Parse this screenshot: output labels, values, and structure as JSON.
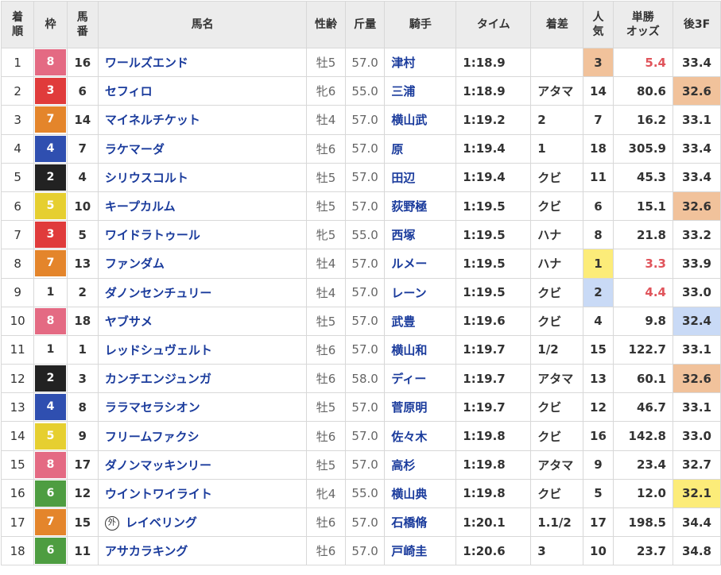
{
  "headers": {
    "rank": [
      "着",
      "順"
    ],
    "waku": "枠",
    "umaban": [
      "馬",
      "番"
    ],
    "name": "馬名",
    "sexage": "性齢",
    "weight": "斤量",
    "jockey": "騎手",
    "time": "タイム",
    "margin": "着差",
    "pop": [
      "人",
      "気"
    ],
    "odds": [
      "単勝",
      "オッズ"
    ],
    "last3f": "後3F"
  },
  "waku_colors": {
    "1": {
      "bg": "#ffffff",
      "fg": "#333333"
    },
    "2": {
      "bg": "#222222",
      "fg": "#ffffff"
    },
    "3": {
      "bg": "#e03b3b",
      "fg": "#ffffff"
    },
    "4": {
      "bg": "#2f4fb0",
      "fg": "#ffffff"
    },
    "5": {
      "bg": "#e6cf30",
      "fg": "#ffffff"
    },
    "6": {
      "bg": "#4e9d41",
      "fg": "#ffffff"
    },
    "7": {
      "bg": "#e4852b",
      "fg": "#ffffff"
    },
    "8": {
      "bg": "#e46a83",
      "fg": "#ffffff"
    }
  },
  "rows": [
    {
      "rank": "1",
      "waku": "8",
      "umaban": "16",
      "name": "ワールズエンド",
      "foreign": "",
      "sexage": "牡5",
      "weight": "57.0",
      "jockey": "津村",
      "time": "1:18.9",
      "margin": "",
      "pop": "3",
      "odds": "5.4",
      "last3f": "33.4",
      "pop_hl": "3",
      "last_hl": ""
    },
    {
      "rank": "2",
      "waku": "3",
      "umaban": "6",
      "name": "セフィロ",
      "foreign": "",
      "sexage": "牝6",
      "weight": "55.0",
      "jockey": "三浦",
      "time": "1:18.9",
      "margin": "アタマ",
      "pop": "14",
      "odds": "80.6",
      "last3f": "32.6",
      "pop_hl": "",
      "last_hl": "3"
    },
    {
      "rank": "3",
      "waku": "7",
      "umaban": "14",
      "name": "マイネルチケット",
      "foreign": "",
      "sexage": "牡4",
      "weight": "57.0",
      "jockey": "横山武",
      "time": "1:19.2",
      "margin": "2",
      "pop": "7",
      "odds": "16.2",
      "last3f": "33.1",
      "pop_hl": "",
      "last_hl": ""
    },
    {
      "rank": "4",
      "waku": "4",
      "umaban": "7",
      "name": "ラケマーダ",
      "foreign": "",
      "sexage": "牡6",
      "weight": "57.0",
      "jockey": "原",
      "time": "1:19.4",
      "margin": "1",
      "pop": "18",
      "odds": "305.9",
      "last3f": "33.4",
      "pop_hl": "",
      "last_hl": ""
    },
    {
      "rank": "5",
      "waku": "2",
      "umaban": "4",
      "name": "シリウスコルト",
      "foreign": "",
      "sexage": "牡5",
      "weight": "57.0",
      "jockey": "田辺",
      "time": "1:19.4",
      "margin": "クビ",
      "pop": "11",
      "odds": "45.3",
      "last3f": "33.4",
      "pop_hl": "",
      "last_hl": ""
    },
    {
      "rank": "6",
      "waku": "5",
      "umaban": "10",
      "name": "キープカルム",
      "foreign": "",
      "sexage": "牡5",
      "weight": "57.0",
      "jockey": "荻野極",
      "time": "1:19.5",
      "margin": "クビ",
      "pop": "6",
      "odds": "15.1",
      "last3f": "32.6",
      "pop_hl": "",
      "last_hl": "3"
    },
    {
      "rank": "7",
      "waku": "3",
      "umaban": "5",
      "name": "ワイドラトゥール",
      "foreign": "",
      "sexage": "牝5",
      "weight": "55.0",
      "jockey": "西塚",
      "time": "1:19.5",
      "margin": "ハナ",
      "pop": "8",
      "odds": "21.8",
      "last3f": "33.2",
      "pop_hl": "",
      "last_hl": ""
    },
    {
      "rank": "8",
      "waku": "7",
      "umaban": "13",
      "name": "ファンダム",
      "foreign": "",
      "sexage": "牡4",
      "weight": "57.0",
      "jockey": "ルメー",
      "time": "1:19.5",
      "margin": "ハナ",
      "pop": "1",
      "odds": "3.3",
      "last3f": "33.9",
      "pop_hl": "1",
      "last_hl": ""
    },
    {
      "rank": "9",
      "waku": "1",
      "umaban": "2",
      "name": "ダノンセンチュリー",
      "foreign": "",
      "sexage": "牡4",
      "weight": "57.0",
      "jockey": "レーン",
      "time": "1:19.5",
      "margin": "クビ",
      "pop": "2",
      "odds": "4.4",
      "last3f": "33.0",
      "pop_hl": "2",
      "last_hl": ""
    },
    {
      "rank": "10",
      "waku": "8",
      "umaban": "18",
      "name": "ヤブサメ",
      "foreign": "",
      "sexage": "牡5",
      "weight": "57.0",
      "jockey": "武豊",
      "time": "1:19.6",
      "margin": "クビ",
      "pop": "4",
      "odds": "9.8",
      "last3f": "32.4",
      "pop_hl": "",
      "last_hl": "2"
    },
    {
      "rank": "11",
      "waku": "1",
      "umaban": "1",
      "name": "レッドシュヴェルト",
      "foreign": "",
      "sexage": "牡6",
      "weight": "57.0",
      "jockey": "横山和",
      "time": "1:19.7",
      "margin": "1/2",
      "pop": "15",
      "odds": "122.7",
      "last3f": "33.1",
      "pop_hl": "",
      "last_hl": ""
    },
    {
      "rank": "12",
      "waku": "2",
      "umaban": "3",
      "name": "カンチエンジュンガ",
      "foreign": "",
      "sexage": "牡6",
      "weight": "58.0",
      "jockey": "ディー",
      "time": "1:19.7",
      "margin": "アタマ",
      "pop": "13",
      "odds": "60.1",
      "last3f": "32.6",
      "pop_hl": "",
      "last_hl": "3"
    },
    {
      "rank": "13",
      "waku": "4",
      "umaban": "8",
      "name": "ララマセラシオン",
      "foreign": "",
      "sexage": "牡5",
      "weight": "57.0",
      "jockey": "菅原明",
      "time": "1:19.7",
      "margin": "クビ",
      "pop": "12",
      "odds": "46.7",
      "last3f": "33.1",
      "pop_hl": "",
      "last_hl": ""
    },
    {
      "rank": "14",
      "waku": "5",
      "umaban": "9",
      "name": "フリームファクシ",
      "foreign": "",
      "sexage": "牡6",
      "weight": "57.0",
      "jockey": "佐々木",
      "time": "1:19.8",
      "margin": "クビ",
      "pop": "16",
      "odds": "142.8",
      "last3f": "33.0",
      "pop_hl": "",
      "last_hl": ""
    },
    {
      "rank": "15",
      "waku": "8",
      "umaban": "17",
      "name": "ダノンマッキンリー",
      "foreign": "",
      "sexage": "牡5",
      "weight": "57.0",
      "jockey": "高杉",
      "time": "1:19.8",
      "margin": "アタマ",
      "pop": "9",
      "odds": "23.4",
      "last3f": "32.7",
      "pop_hl": "",
      "last_hl": ""
    },
    {
      "rank": "16",
      "waku": "6",
      "umaban": "12",
      "name": "ウイントワイライト",
      "foreign": "",
      "sexage": "牝4",
      "weight": "55.0",
      "jockey": "横山典",
      "time": "1:19.8",
      "margin": "クビ",
      "pop": "5",
      "odds": "12.0",
      "last3f": "32.1",
      "pop_hl": "",
      "last_hl": "1"
    },
    {
      "rank": "17",
      "waku": "7",
      "umaban": "15",
      "name": "レイベリング",
      "foreign": "外",
      "sexage": "牡6",
      "weight": "57.0",
      "jockey": "石橋脩",
      "time": "1:20.1",
      "margin": "1.1/2",
      "pop": "17",
      "odds": "198.5",
      "last3f": "34.4",
      "pop_hl": "",
      "last_hl": ""
    },
    {
      "rank": "18",
      "waku": "6",
      "umaban": "11",
      "name": "アサカラキング",
      "foreign": "",
      "sexage": "牡6",
      "weight": "57.0",
      "jockey": "戸崎圭",
      "time": "1:20.6",
      "margin": "3",
      "pop": "10",
      "odds": "23.7",
      "last3f": "34.8",
      "pop_hl": "",
      "last_hl": ""
    }
  ]
}
